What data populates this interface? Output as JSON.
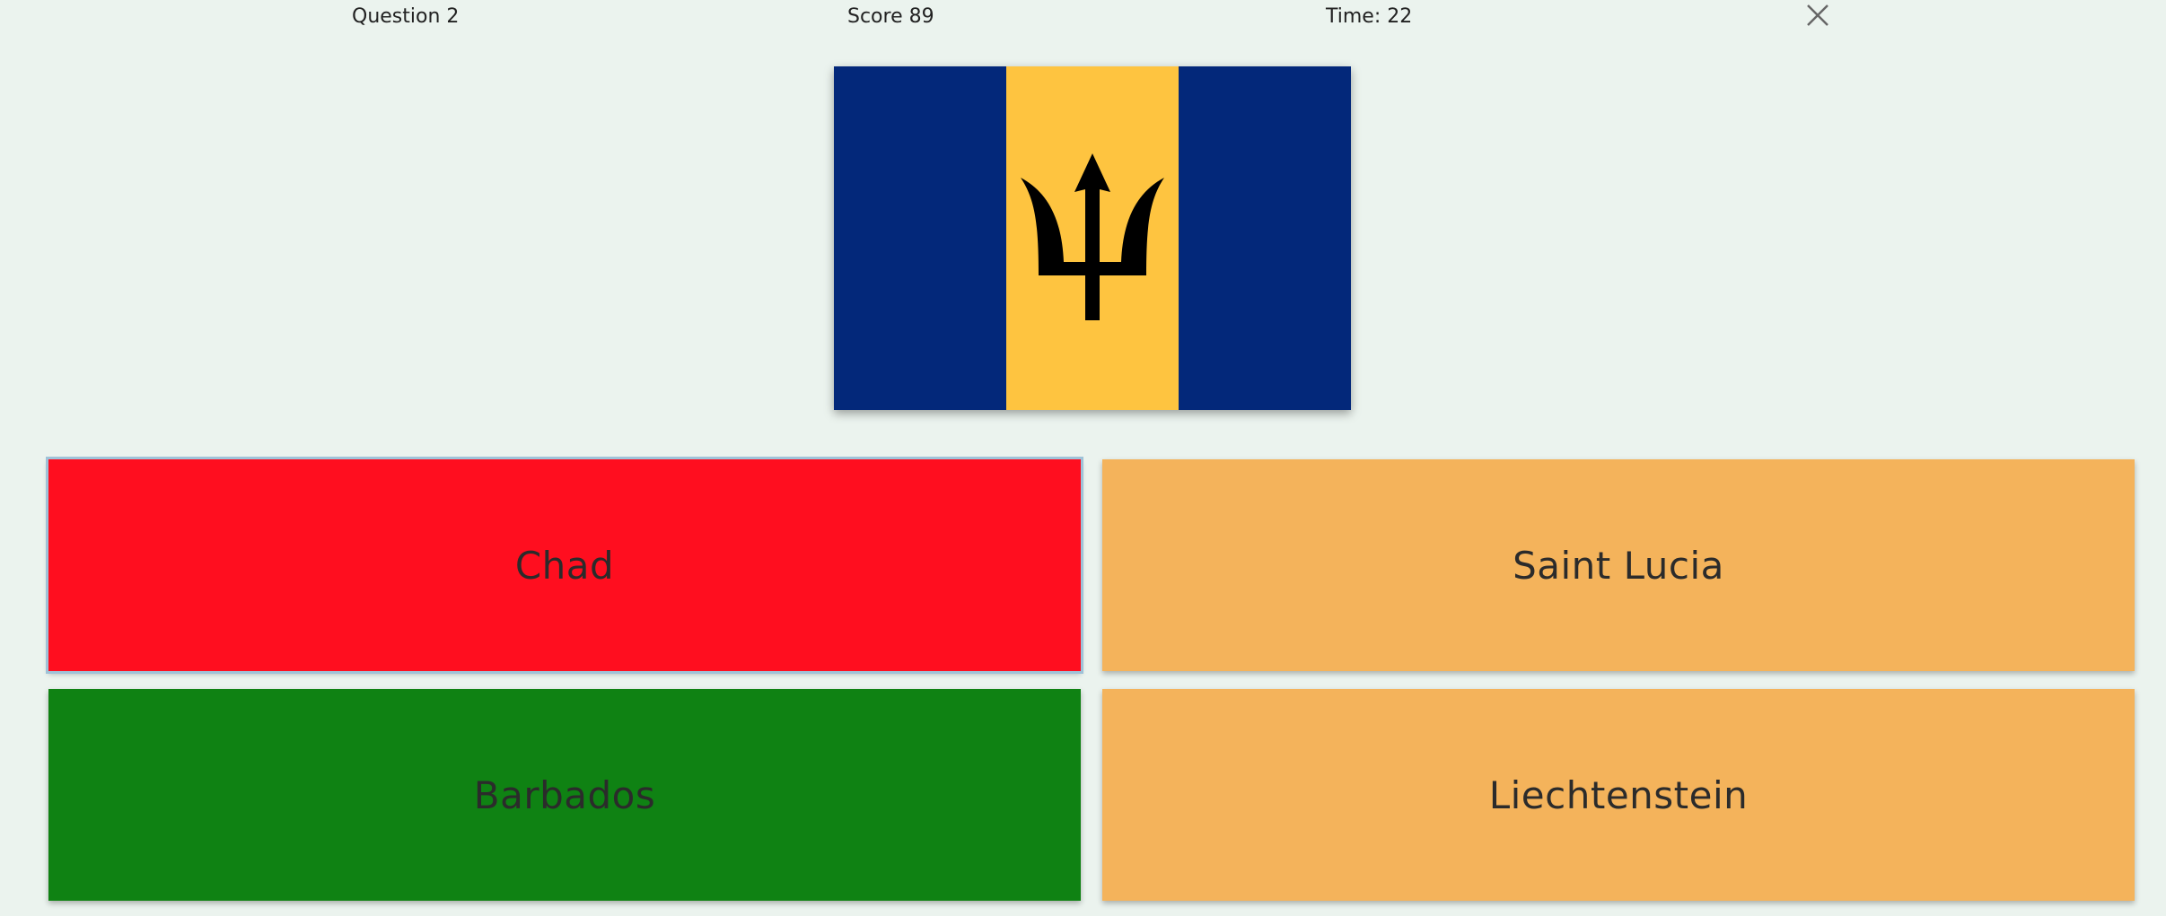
{
  "header": {
    "question_label": "Question 2",
    "score_label": "Score 89",
    "time_label": "Time: 22",
    "close_icon": "close-icon"
  },
  "flag": {
    "icon": "barbados-flag",
    "colors": {
      "blue": "#03287a",
      "gold": "#fec440",
      "trident": "#000000"
    }
  },
  "answers": [
    {
      "label": "Chad",
      "state": "wrong-selected",
      "color": "#ff0e1f"
    },
    {
      "label": "Saint Lucia",
      "state": "neutral",
      "color": "#f4b35b"
    },
    {
      "label": "Barbados",
      "state": "correct",
      "color": "#0f8213"
    },
    {
      "label": "Liechtenstein",
      "state": "neutral",
      "color": "#f4b35b"
    }
  ]
}
